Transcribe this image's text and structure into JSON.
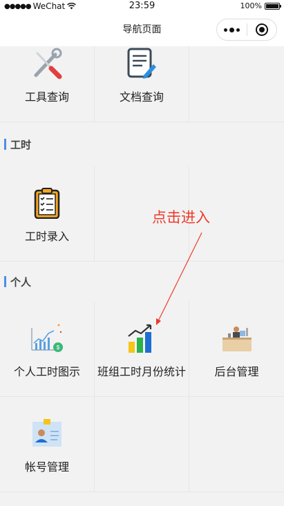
{
  "status_bar": {
    "carrier": "WeChat",
    "time": "23:59",
    "battery_percent": "100%"
  },
  "nav_bar": {
    "title": "导航页面"
  },
  "tools_section": {
    "items": [
      {
        "label": "工具查询",
        "icon": "tools-icon"
      },
      {
        "label": "文档查询",
        "icon": "document-icon"
      }
    ]
  },
  "work_hours_section": {
    "title": "工时",
    "items": [
      {
        "label": "工时录入",
        "icon": "clipboard-checklist-icon"
      }
    ]
  },
  "personal_section": {
    "title": "个人",
    "items": [
      {
        "label": "个人工时图示",
        "icon": "line-chart-money-icon"
      },
      {
        "label": "班组工时月份统计",
        "icon": "bar-chart-icon"
      },
      {
        "label": "后台管理",
        "icon": "desk-admin-icon"
      },
      {
        "label": "帐号管理",
        "icon": "id-card-icon"
      }
    ]
  },
  "annotation": {
    "text": "点击进入",
    "color": "#ee3a2c"
  },
  "colors": {
    "section_accent": "#4a90e2",
    "background": "#f2f2f2"
  }
}
